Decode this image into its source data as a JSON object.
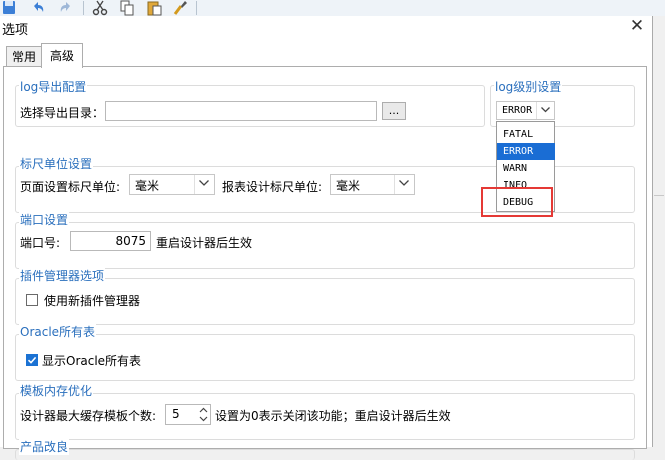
{
  "dialog": {
    "title": "选项"
  },
  "tabs": [
    {
      "label": "常用",
      "active": false
    },
    {
      "label": "高级",
      "active": true
    }
  ],
  "log_export": {
    "legend": "log导出配置",
    "dir_label": "选择导出目录：",
    "dir_value": "",
    "browse_label": "..."
  },
  "log_level": {
    "legend": "log级别设置",
    "selected": "ERROR",
    "options": [
      "FATAL",
      "ERROR",
      "WARN",
      "INFO",
      "DEBUG"
    ],
    "highlighted": "ERROR",
    "annotation_color": "#e53935"
  },
  "ruler": {
    "legend": "标尺单位设置",
    "page_label": "页面设置标尺单位:",
    "page_value": "毫米",
    "report_label": "报表设计标尺单位:",
    "report_value": "毫米"
  },
  "port": {
    "legend": "端口设置",
    "label": "端口号:",
    "value": "8075",
    "note": "重启设计器后生效"
  },
  "plugin": {
    "legend": "插件管理器选项",
    "checkbox_label": "使用新插件管理器",
    "checked": false
  },
  "oracle": {
    "legend": "Oracle所有表",
    "checkbox_label": "显示Oracle所有表",
    "checked": true
  },
  "template_cache": {
    "legend": "模板内存优化",
    "label": "设计器最大缓存模板个数:",
    "value": "5",
    "note": "设置为0表示关闭该功能；重启设计器后生效"
  },
  "product": {
    "legend": "产品改良"
  },
  "colors": {
    "accent": "#1b72d3",
    "legend_text": "#2a6fbd",
    "highlight_box": "#e53935"
  }
}
